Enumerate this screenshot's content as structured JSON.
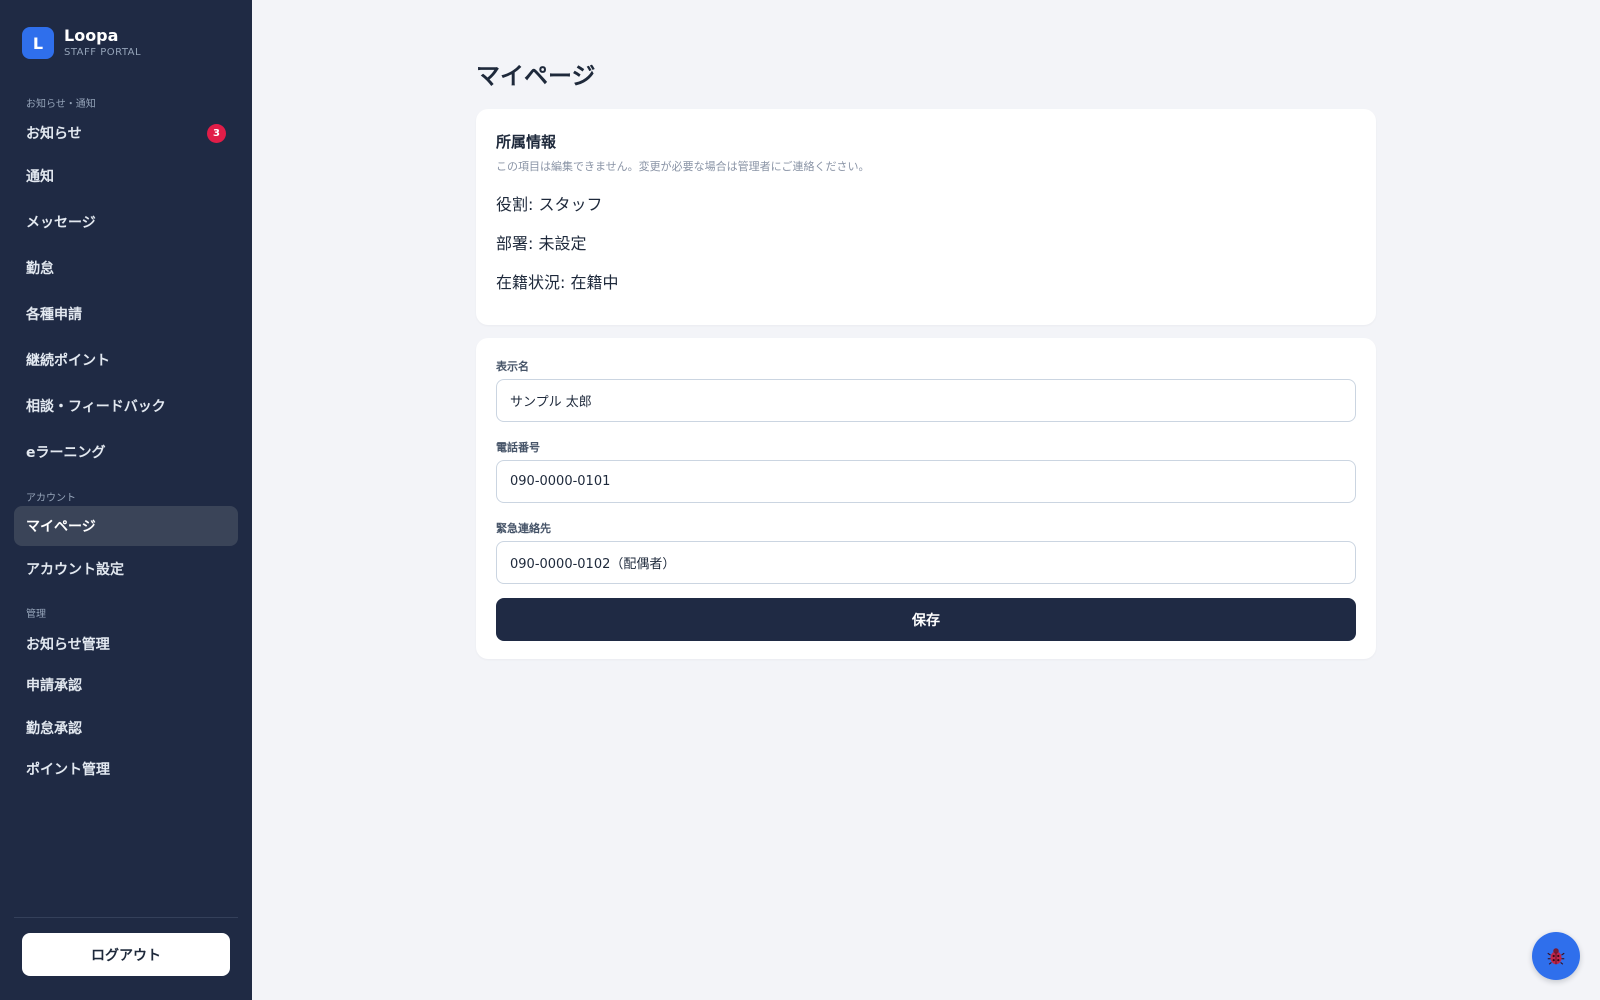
{
  "brand": {
    "logo_letter": "L",
    "name": "Loopa",
    "subtitle": "STAFF PORTAL"
  },
  "sidebar": {
    "sections": [
      {
        "label": "お知らせ・通知",
        "items": [
          {
            "label": "お知らせ",
            "badge": "3"
          },
          {
            "label": "通知"
          },
          {
            "label": "メッセージ"
          },
          {
            "label": "勤怠"
          },
          {
            "label": "各種申請"
          },
          {
            "label": "継続ポイント"
          },
          {
            "label": "相談・フィードバック"
          },
          {
            "label": "eラーニング"
          }
        ]
      },
      {
        "label": "アカウント",
        "items": [
          {
            "label": "マイページ",
            "active": true
          },
          {
            "label": "アカウント設定"
          }
        ]
      },
      {
        "label": "管理",
        "items": [
          {
            "label": "お知らせ管理"
          },
          {
            "label": "申請承認"
          },
          {
            "label": "勤怠承認"
          },
          {
            "label": "ポイント管理"
          }
        ]
      }
    ],
    "logout_label": "ログアウト"
  },
  "main": {
    "title": "マイページ",
    "affiliation": {
      "title": "所属情報",
      "note": "この項目は編集できません。変更が必要な場合は管理者にご連絡ください。",
      "rows": [
        "役割: スタッフ",
        "部署: 未設定",
        "在籍状況: 在籍中"
      ]
    },
    "form": {
      "fields": [
        {
          "label": "表示名",
          "value": "サンプル 太郎"
        },
        {
          "label": "電話番号",
          "value": "090-0000-0101"
        },
        {
          "label": "緊急連絡先",
          "value": "090-0000-0102（配偶者）"
        }
      ],
      "save_label": "保存"
    }
  },
  "colors": {
    "sidebar_bg": "#1f2a44",
    "accent": "#2f6fec",
    "badge": "#e11d48",
    "page_bg": "#f3f4f8"
  },
  "icons": {
    "fab": "bug-icon"
  }
}
